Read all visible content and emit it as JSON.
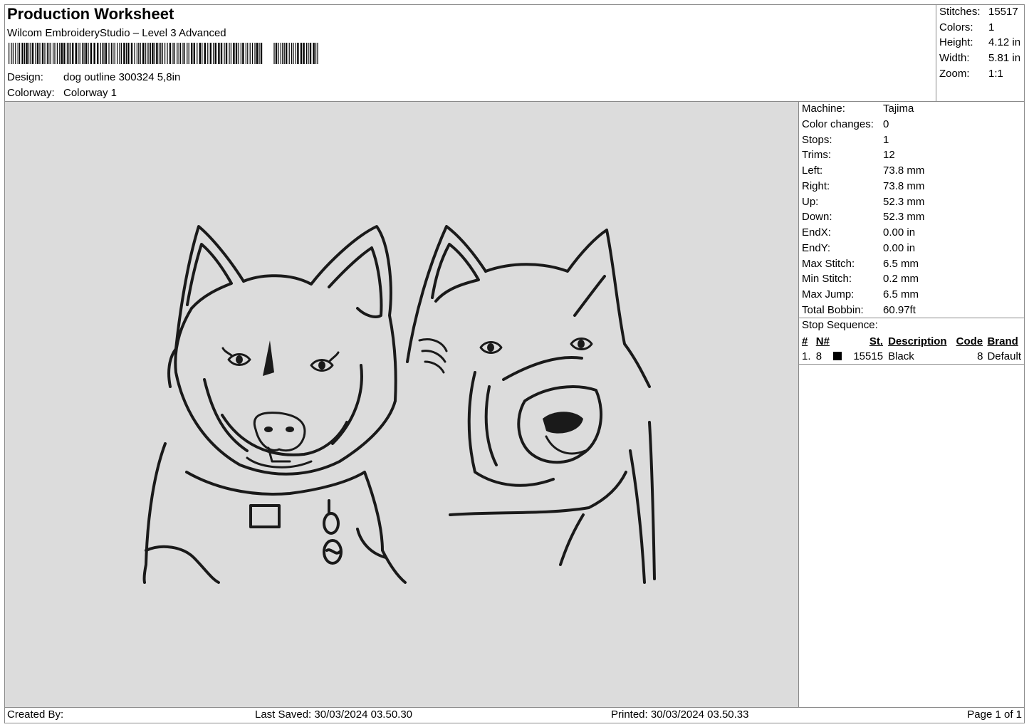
{
  "header": {
    "title": "Production Worksheet",
    "software": "Wilcom EmbroideryStudio – Level 3 Advanced",
    "design_label": "Design:",
    "design_value": "dog outline 300324 5,8in",
    "colorway_label": "Colorway:",
    "colorway_value": "Colorway 1"
  },
  "summary": [
    {
      "label": "Stitches:",
      "value": "15517"
    },
    {
      "label": "Colors:",
      "value": "1"
    },
    {
      "label": "Height:",
      "value": "4.12 in"
    },
    {
      "label": "Width:",
      "value": "5.81 in"
    },
    {
      "label": "Zoom:",
      "value": "1:1"
    }
  ],
  "machine_info": [
    {
      "label": "Machine:",
      "value": "Tajima"
    },
    {
      "label": "Color changes:",
      "value": "0"
    },
    {
      "label": "Stops:",
      "value": "1"
    },
    {
      "label": "Trims:",
      "value": "12"
    },
    {
      "label": "Left:",
      "value": "73.8 mm"
    },
    {
      "label": "Right:",
      "value": "73.8 mm"
    },
    {
      "label": "Up:",
      "value": "52.3 mm"
    },
    {
      "label": "Down:",
      "value": "52.3 mm"
    },
    {
      "label": "EndX:",
      "value": "0.00 in"
    },
    {
      "label": "EndY:",
      "value": "0.00 in"
    },
    {
      "label": "Max Stitch:",
      "value": "6.5 mm"
    },
    {
      "label": "Min Stitch:",
      "value": "0.2 mm"
    },
    {
      "label": "Max Jump:",
      "value": "6.5 mm"
    },
    {
      "label": "Total Bobbin:",
      "value": "60.97ft"
    }
  ],
  "stop_sequence": {
    "label": "Stop Sequence:",
    "headers": {
      "num": "#",
      "needle": "N#",
      "stitches": "St.",
      "description": "Description",
      "code": "Code",
      "brand": "Brand"
    },
    "rows": [
      {
        "num": "1.",
        "needle": "8",
        "swatch": "#000000",
        "stitches": "15515",
        "description": "Black",
        "code": "8",
        "brand": "Default"
      }
    ]
  },
  "footer": {
    "created_by": "Created By:",
    "last_saved": "Last Saved: 30/03/2024 03.50.30",
    "printed": "Printed: 30/03/2024 03.50.33",
    "page": "Page 1 of 1"
  },
  "colors": {
    "canvas_bg": "#dcdcdc",
    "thread": "#1a1a1a",
    "border": "#8a8a8a"
  }
}
